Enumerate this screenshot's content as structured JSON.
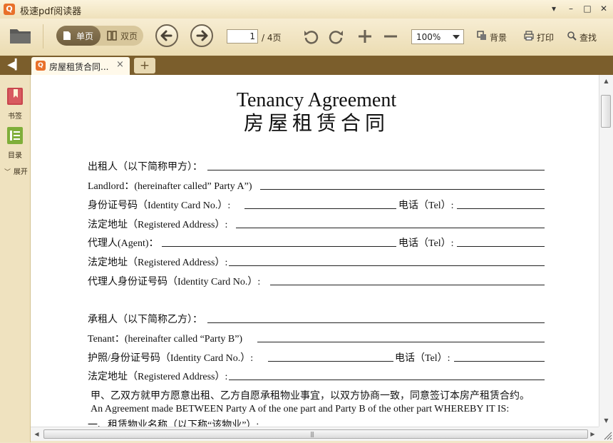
{
  "window": {
    "title": "极速pdf阅读器",
    "controls": [
      "▾",
      "–",
      "□",
      "✕"
    ]
  },
  "toolbar": {
    "single_page_label": "单页",
    "double_page_label": "双页",
    "current_page": "1",
    "page_total": "/ 4页",
    "zoom": "100%",
    "background_label": "背景",
    "print_label": "打印",
    "find_label": "查找"
  },
  "tabs": {
    "active_title": "房屋租赁合同...",
    "close": "×",
    "new": "+",
    "sidebar_toggle": "◀▎"
  },
  "sidebar": {
    "bookmarks": "书签",
    "toc": "目录",
    "expand": "展开"
  },
  "document": {
    "title_en": "Tenancy Agreement",
    "title_cn": "房屋租赁合同",
    "rows": [
      {
        "label": "出租人（以下简称甲方）："
      },
      {
        "label": "Landlord：(hereinafter called” Party A”)"
      },
      {
        "label": "身份证号码（Identity Card No.）:",
        "label2": "电话（Tel）:"
      },
      {
        "label": "法定地址（Registered Address）:"
      },
      {
        "label": "代理人(Agent)：",
        "label2": "电话（Tel）:"
      },
      {
        "label": "法定地址（Registered Address）:"
      },
      {
        "label": "代理人身份证号码（Identity Card No.）:"
      },
      {
        "label": "承租人（以下简称乙方）："
      },
      {
        "label": "Tenant：(hereinafter called “Party B”)"
      },
      {
        "label": "护照/身份证号码（Identity Card No.）:",
        "label2": "电话（Tel）:"
      },
      {
        "label": "法定地址（Registered Address）:"
      }
    ],
    "para_cn": "甲、乙双方就甲方愿意出租、乙方自愿承租物业事宜，以双方协商一致，同意签订本房产租赁合约。",
    "para_en": "An Agreement made BETWEEN Party A of the one part and Party B of the other part WHEREBY IT IS:",
    "section1": "一、租赁物业名称（以下称“该物业”）:"
  }
}
